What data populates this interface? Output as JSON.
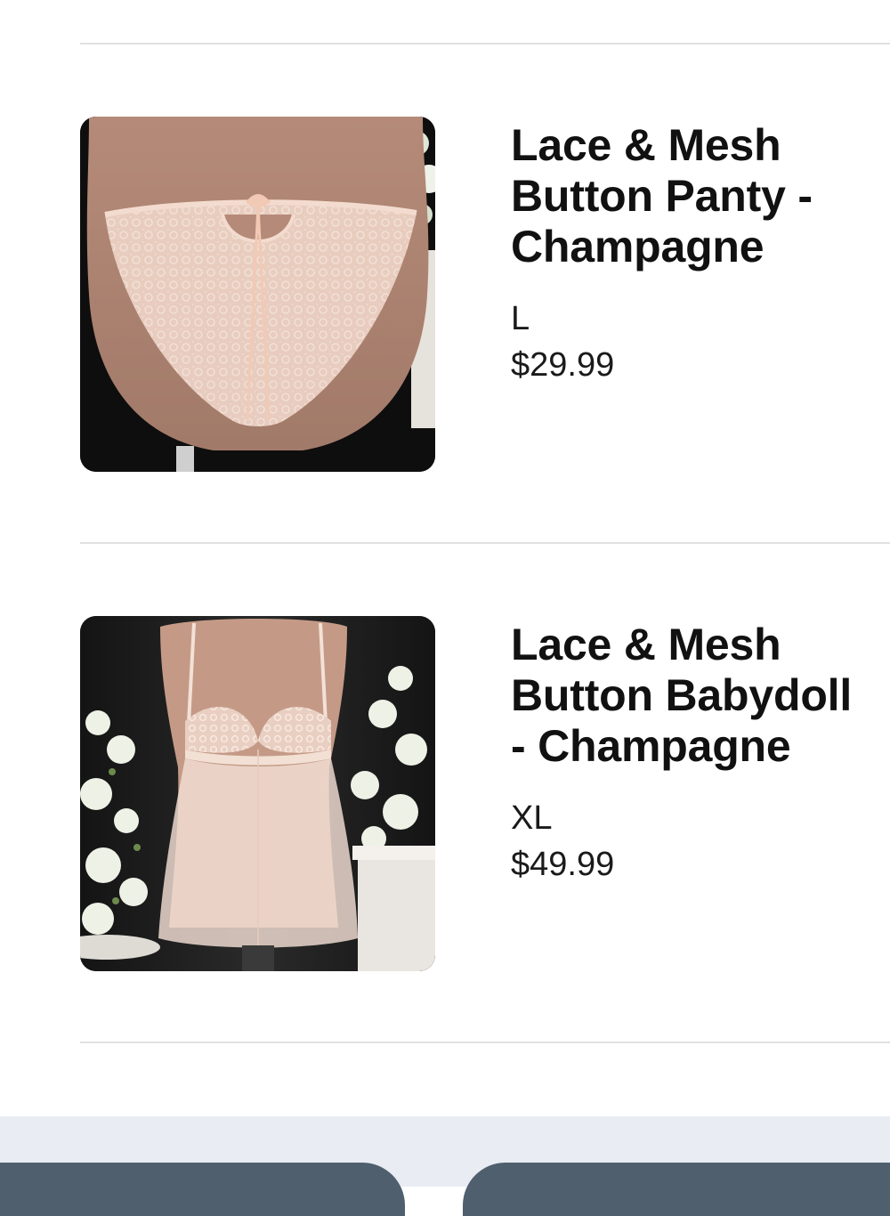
{
  "cart": {
    "items": [
      {
        "title": "Lace & Mesh Button Panty - Champagne",
        "size": "L",
        "price": "$29.99",
        "image_subject": "panty-product-photo"
      },
      {
        "title": "Lace & Mesh Button Babydoll - Champagne",
        "size": "XL",
        "price": "$49.99",
        "image_subject": "babydoll-product-photo"
      }
    ]
  },
  "footer": {
    "left_button_label": "",
    "right_button_label": ""
  },
  "colors": {
    "divider": "#e1e1e1",
    "footer_background": "#e9edf3",
    "footer_button": "#4f5f6e",
    "text": "#111111"
  }
}
